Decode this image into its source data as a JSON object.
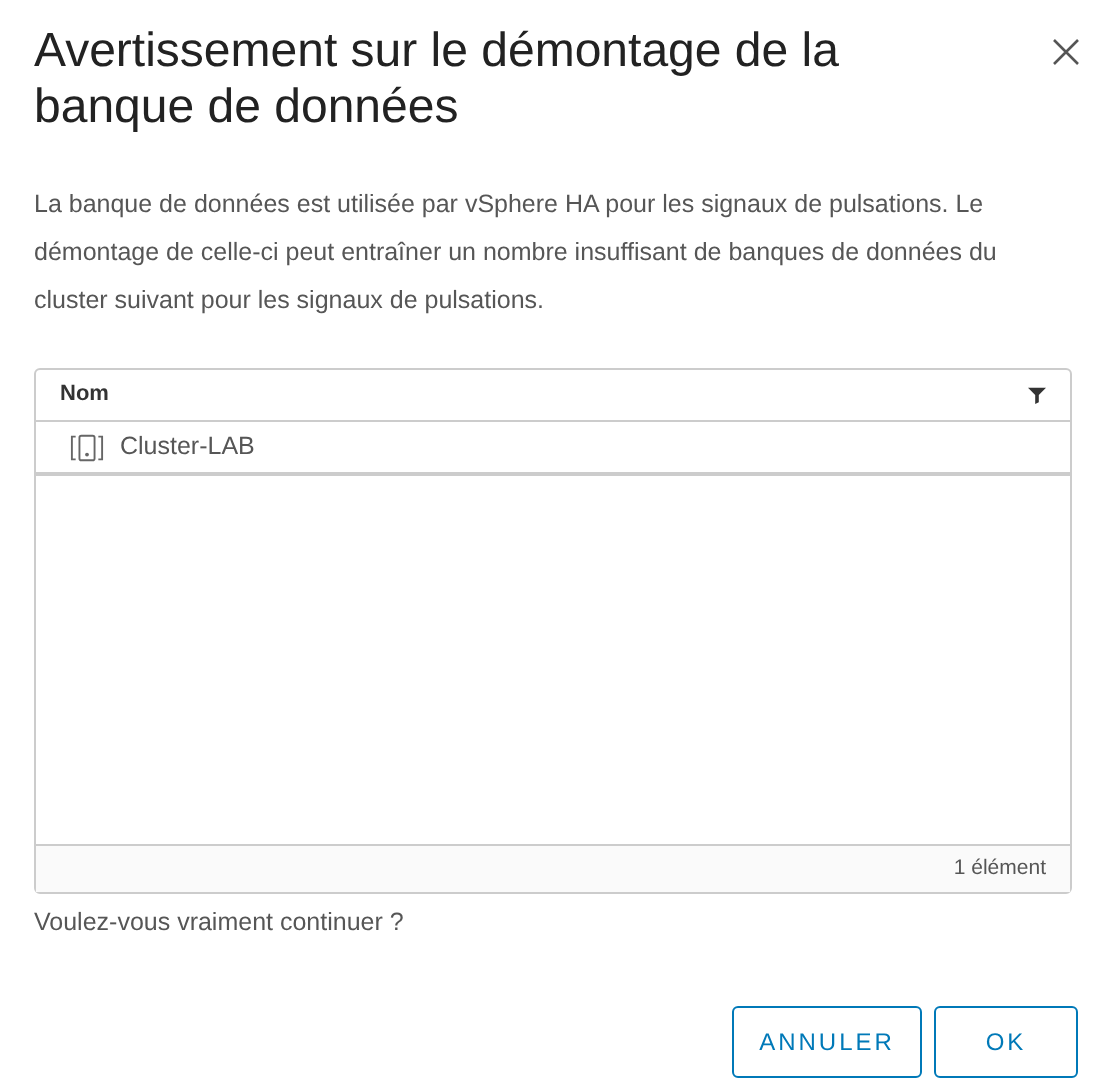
{
  "dialog": {
    "title": "Avertissement sur le démontage de la banque de données",
    "message": "La banque de données est utilisée par vSphere HA pour les signaux de pulsations. Le démontage de celle-ci peut entraîner un nombre insuffisant de banques de données du cluster suivant pour les signaux de pulsations.",
    "table": {
      "columns": [
        "Nom"
      ],
      "rows": [
        {
          "name": "Cluster-LAB"
        }
      ],
      "footer": "1 élément"
    },
    "question": "Voulez-vous vraiment continuer ?",
    "buttons": [
      "ANNULER",
      "OK"
    ]
  }
}
